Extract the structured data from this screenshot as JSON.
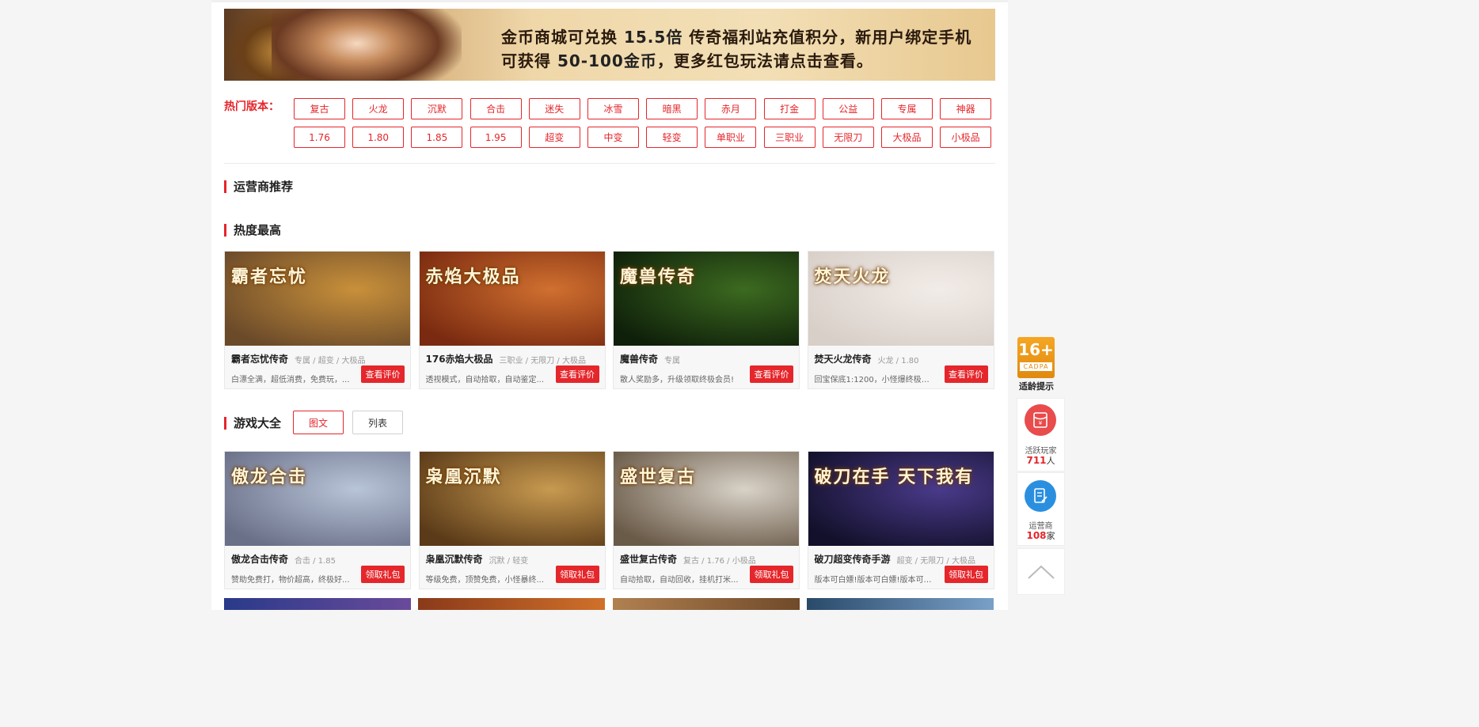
{
  "banner": {
    "line1_a": "金币商城可兑换",
    "line1_b": "15.5倍",
    "line1_c": "传奇福利站充值积分，新用户绑定手机",
    "line2_a": "可获得",
    "line2_b": "50-100金币",
    "line2_c": "，更多红包玩法请点击查看。"
  },
  "hot": {
    "label": "热门版本：",
    "row1": [
      "复古",
      "火龙",
      "沉默",
      "合击",
      "迷失",
      "冰雪",
      "暗黑",
      "赤月",
      "打金",
      "公益",
      "专属",
      "神器"
    ],
    "row2": [
      "1.76",
      "1.80",
      "1.85",
      "1.95",
      "超变",
      "中变",
      "轻变",
      "单职业",
      "三职业",
      "无限刀",
      "大极品",
      "小极品"
    ]
  },
  "sections": {
    "operators": "运营商推荐",
    "hottest": "热度最高",
    "all_games": "游戏大全"
  },
  "view_toggle": {
    "graphic": "图文",
    "list": "列表"
  },
  "hottest_cards": [
    {
      "name": "霸者忘忧传奇",
      "tags": "专属 / 超变 / 大极品",
      "desc": "白漂全满，超低消费，免费玩，...",
      "btn": "查看评价",
      "thumb_title": "霸者忘忧",
      "c1": "#c8903a",
      "c2": "#6b4a2a"
    },
    {
      "name": "176赤焰大极品",
      "tags": "三职业 / 无限刀 / 大极品",
      "desc": "透视模式，自动拾取，自动鉴定...",
      "btn": "查看评价",
      "thumb_title": "赤焰大极品",
      "c1": "#d07030",
      "c2": "#7a2a10"
    },
    {
      "name": "魔兽传奇",
      "tags": "专属",
      "desc": "散人奖励多，升级领取终极会员!",
      "btn": "查看评价",
      "thumb_title": "魔兽传奇",
      "c1": "#3c6a20",
      "c2": "#0f200a"
    },
    {
      "name": "焚天火龙传奇",
      "tags": "火龙 / 1.80",
      "desc": "回宝保底1:1200，小怪爆终极，...",
      "btn": "查看评价",
      "thumb_title": "焚天火龙",
      "c1": "#f2ece8",
      "c2": "#d8cfc8"
    }
  ],
  "all_cards": [
    {
      "name": "傲龙合击传奇",
      "tags": "合击 / 1.85",
      "desc": "赞助免费打，物价超高，终极好...",
      "btn": "领取礼包",
      "thumb_title": "傲龙合击",
      "c1": "#b8c4d8",
      "c2": "#6a7088"
    },
    {
      "name": "枭凰沉默传奇",
      "tags": "沉默 / 轻变",
      "desc": "等级免费，顶赞免费，小怪暴终...",
      "btn": "领取礼包",
      "thumb_title": "枭凰沉默",
      "c1": "#c89a50",
      "c2": "#5a3a18"
    },
    {
      "name": "盛世复古传奇",
      "tags": "复古 / 1.76 / 小极品",
      "desc": "自动拾取，自动回收，挂机打米...",
      "btn": "领取礼包",
      "thumb_title": "盛世复古",
      "c1": "#d8d2c8",
      "c2": "#6a5a48"
    },
    {
      "name": "破刀超变传奇手游",
      "tags": "超变 / 无限刀 / 大极品",
      "desc": "版本可白嫖!版本可白嫖!版本可白...",
      "btn": "领取礼包",
      "thumb_title": "破刀在手 天下我有",
      "c1": "#4a3a8a",
      "c2": "#12102a"
    }
  ],
  "sidebar": {
    "age_number": "16+",
    "age_code": "CADPA",
    "age_label": "适龄提示",
    "active_label": "活跃玩家",
    "active_count": "711",
    "active_unit": "人",
    "operator_label": "运营商",
    "operator_count": "108",
    "operator_unit": "家"
  }
}
